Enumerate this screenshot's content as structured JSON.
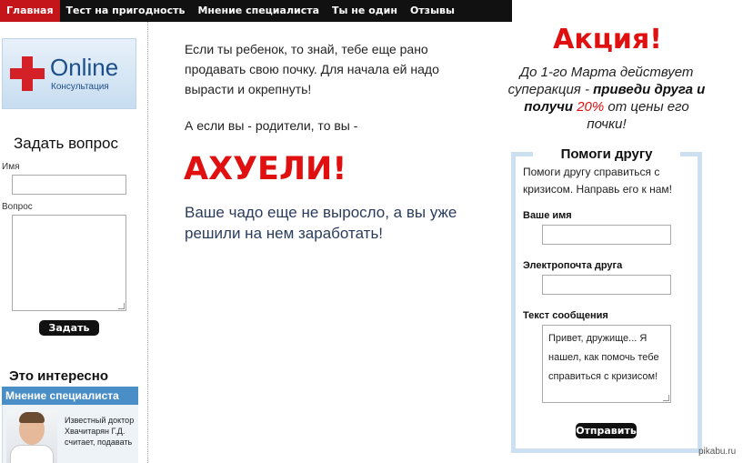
{
  "nav": {
    "items": [
      "Главная",
      "Тест на пригодность",
      "Мнение специалиста",
      "Ты не один",
      "Отзывы"
    ]
  },
  "sidebar": {
    "logo_word": "Online",
    "logo_sub": "Консультация",
    "ask_title": "Задать вопрос",
    "name_label": "Имя",
    "question_label": "Вопрос",
    "submit_label": "Задать",
    "interesting_title": "Это интересно",
    "expert_bar": "Мнение специалиста",
    "expert_text": "Известный доктор Хвачитарян Г.Д. считает, подавать"
  },
  "main": {
    "paragraph1": "Если ты ребенок, то знай, тебе еще рано продавать свою почку. Для начала ей надо вырасти и окрепнуть!",
    "paragraph2": "А если вы - родители, то вы -",
    "headline": "АХУЕЛИ!",
    "paragraph3": "Ваше чадо еще не выросло, а вы уже решили на нем заработать!"
  },
  "promo": {
    "title": "Акция!",
    "line1": "До 1-го Марта действует суперакция - ",
    "bold_part": "приведи друга и получи ",
    "percent": "20%",
    "line2": " от цены его почки!"
  },
  "help_form": {
    "title": "Помоги другу",
    "description": "Помоги другу справиться с кризисом. Направь его к нам!",
    "name_label": "Ваше имя",
    "email_label": "Электропочта друга",
    "message_label": "Текст сообщения",
    "message_value": "Привет, дружище... Я нашел, как помочь тебе справиться с кризисом!",
    "send_label": "Отправить"
  },
  "watermark": "pikabu.ru",
  "colors": {
    "accent_red": "#e01010",
    "nav_active": "#c4151a",
    "nav_bg": "#111111",
    "panel_blue": "#4a8ec8"
  }
}
